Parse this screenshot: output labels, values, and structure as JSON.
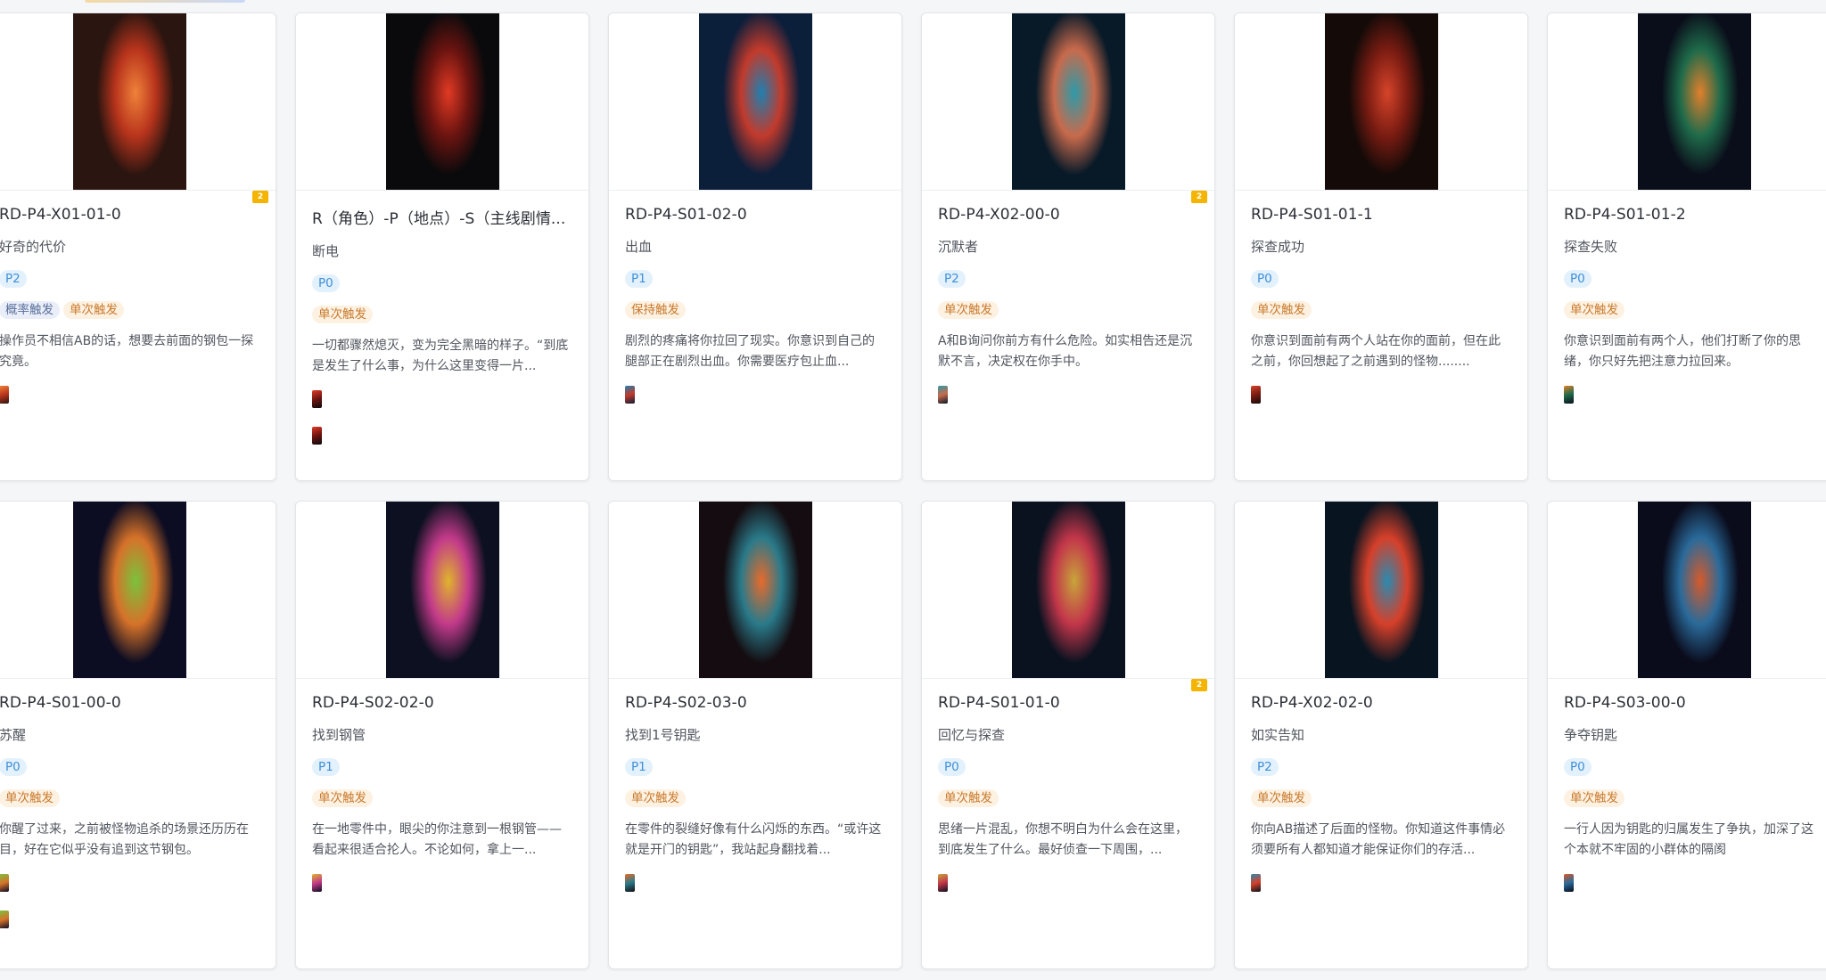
{
  "cards": [
    {
      "id": "RD-P4-X01-01-0",
      "name": "好奇的代价",
      "priority": "P2",
      "triggers": [
        "概率触发",
        "单次触发"
      ],
      "desc": "操作员不相信AB的话，想要去前面的钢包一探究竟。",
      "badge": "2",
      "image_icon": "dark-corridor-orange-door-image",
      "colors": [
        "#f0823a",
        "#b8341c",
        "#2b1510"
      ],
      "minis": 1
    },
    {
      "id": "R（角色）-P（地点）-S（主线剧情...",
      "name": "断电",
      "priority": "P0",
      "triggers": [
        "单次触发"
      ],
      "desc": "一切都骤然熄灭，变为完全黑暗的样子。“到底是发生了什么事，为什么这里变得一片...",
      "badge": "",
      "image_icon": "red-lit-corridor-image",
      "colors": [
        "#e23a24",
        "#6b1410",
        "#0a0a0c"
      ],
      "minis": 2
    },
    {
      "id": "RD-P4-S01-02-0",
      "name": "出血",
      "priority": "P1",
      "triggers": [
        "保持触发"
      ],
      "desc": "剧烈的疼痛将你拉回了现实。你意识到自己的腿部正在剧烈出血。你需要医疗包止血...",
      "badge": "",
      "image_icon": "wounded-figure-floor-image",
      "colors": [
        "#1f7fb0",
        "#c23a2c",
        "#0b1e3a"
      ],
      "minis": 1
    },
    {
      "id": "RD-P4-X02-00-0",
      "name": "沉默者",
      "priority": "P2",
      "triggers": [
        "单次触发"
      ],
      "desc": "A和B询问你前方有什么危险。如实相告还是沉默不言，决定权在你手中。",
      "badge": "2",
      "image_icon": "two-figures-corridor-image",
      "colors": [
        "#2d9aa8",
        "#c86a4c",
        "#081a28"
      ],
      "minis": 1
    },
    {
      "id": "RD-P4-S01-01-1",
      "name": "探查成功",
      "priority": "P0",
      "triggers": [
        "单次触发"
      ],
      "desc": "你意识到面前有两个人站在你的面前，但在此之前，你回想起了之前遇到的怪物........",
      "badge": "",
      "image_icon": "monster-doorway-image",
      "colors": [
        "#d6442a",
        "#7a1c12",
        "#140a08"
      ],
      "minis": 1
    },
    {
      "id": "RD-P4-S01-01-2",
      "name": "探查失败",
      "priority": "P0",
      "triggers": [
        "单次触发"
      ],
      "desc": "你意识到面前有两个人，他们打断了你的思绪，你只好先把注意力拉回来。",
      "badge": "",
      "image_icon": "figures-in-doorway-image",
      "colors": [
        "#e2802c",
        "#1e6a4a",
        "#0a0d1a"
      ],
      "minis": 1
    },
    {
      "id": "RD-P4-S01-00-0",
      "name": "苏醒",
      "priority": "P0",
      "triggers": [
        "单次触发"
      ],
      "desc": "你醒了过来，之前被怪物追杀的场景还历历在目，好在它似乎没有追到这节钢包。",
      "badge": "",
      "image_icon": "figure-green-door-image",
      "colors": [
        "#7ac23c",
        "#d6722a",
        "#0c0c22"
      ],
      "minis": 2
    },
    {
      "id": "RD-P4-S02-02-0",
      "name": "找到钢管",
      "priority": "P1",
      "triggers": [
        "单次触发"
      ],
      "desc": "在一地零件中，眼尖的你注意到一根钢管——看起来很适合抡人。不论如何，拿上一...",
      "badge": "",
      "image_icon": "figure-bright-doorway-image",
      "colors": [
        "#e0b42c",
        "#c23a8a",
        "#0c1020"
      ],
      "minis": 1
    },
    {
      "id": "RD-P4-S02-03-0",
      "name": "找到1号钥匙",
      "priority": "P1",
      "triggers": [
        "单次触发"
      ],
      "desc": "在零件的裂缝好像有什么闪烁的东西。“或许这就是开门的钥匙”，我站起身翻找着...",
      "badge": "",
      "image_icon": "face-close-up-image",
      "colors": [
        "#e86a2a",
        "#2a7a8a",
        "#140c10"
      ],
      "minis": 1
    },
    {
      "id": "RD-P4-S01-01-0",
      "name": "回忆与探查",
      "priority": "P0",
      "triggers": [
        "单次触发"
      ],
      "desc": "思绪一片混乱，你想不明白为什么会在这里，到底发生了什么。最好侦查一下周围，...",
      "badge": "2",
      "image_icon": "seated-figure-corridor-image",
      "colors": [
        "#c8a43a",
        "#c2364a",
        "#0a1220"
      ],
      "minis": 1
    },
    {
      "id": "RD-P4-X02-02-0",
      "name": "如实告知",
      "priority": "P2",
      "triggers": [
        "单次触发"
      ],
      "desc": "你向AB描述了后面的怪物。你知道这件事情必须要所有人都知道才能保证你们的存活...",
      "badge": "",
      "image_icon": "two-seated-figures-image",
      "colors": [
        "#2a8ab0",
        "#d6402a",
        "#081420"
      ],
      "minis": 1
    },
    {
      "id": "RD-P4-S03-00-0",
      "name": "争夺钥匙",
      "priority": "P0",
      "triggers": [
        "单次触发"
      ],
      "desc": "一行人因为钥匙的归属发生了争执，加深了这个本就不牢固的小群体的隔阂",
      "badge": "",
      "image_icon": "arguing-figures-image",
      "colors": [
        "#d65a2a",
        "#2a6a9a",
        "#0a0c1c"
      ],
      "minis": 1
    }
  ]
}
